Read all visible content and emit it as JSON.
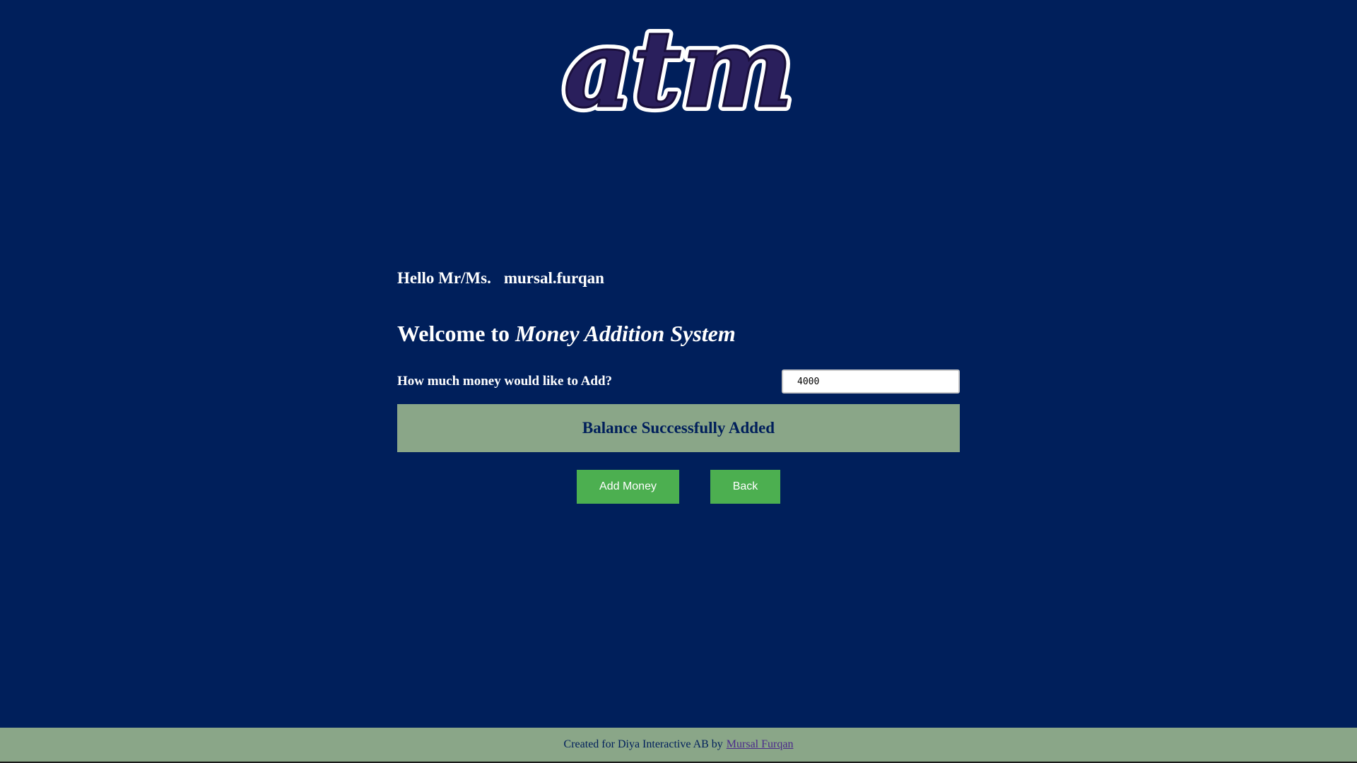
{
  "logo": {
    "text": "atm"
  },
  "greeting": {
    "prefix": "Hello Mr/Ms.",
    "username": "mursal.furqan"
  },
  "welcome": {
    "prefix": "Welcome to",
    "system_name": "Money Addition System"
  },
  "form": {
    "amount_label": "How much money would like to Add?",
    "amount_value": "4000"
  },
  "status": {
    "message": "Balance Successfully Added"
  },
  "actions": {
    "add_money_label": "Add Money",
    "back_label": "Back"
  },
  "footer": {
    "text": "Created for Diya Interactive AB by",
    "author_link": "Mursal Furqan"
  },
  "colors": {
    "background": "#001f5b",
    "status_bar": "#8aa688",
    "button": "#4caf50"
  }
}
